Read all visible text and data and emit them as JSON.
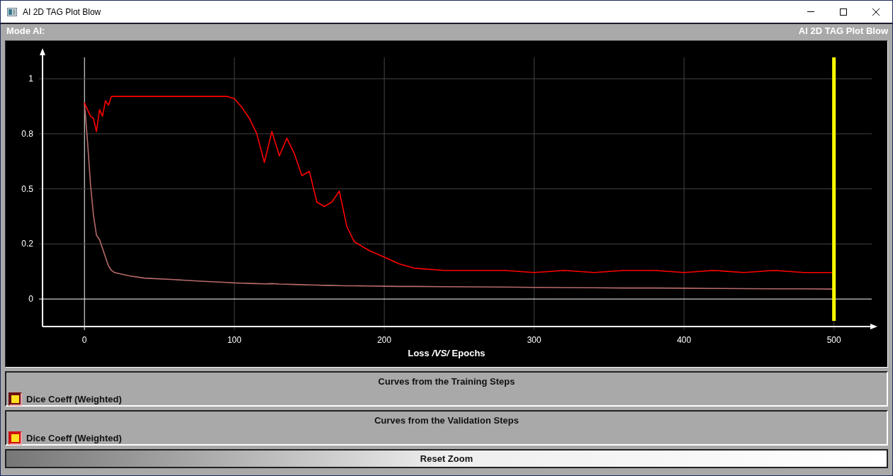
{
  "window": {
    "title": "AI 2D TAG Plot Blow"
  },
  "header": {
    "mode_label": "Mode AI:",
    "app_name": "AI 2D TAG Plot Blow"
  },
  "chart": {
    "chart_data": {
      "type": "line",
      "xlabel": "Loss */VS/* Epochs",
      "xlim": [
        -28,
        529
      ],
      "ylim": [
        -0.125,
        1.11
      ],
      "xticks": [
        0,
        100,
        200,
        300,
        400,
        500
      ],
      "yticks": [
        {
          "value": 0,
          "label": "0"
        },
        {
          "value": 0.25,
          "label": "0.2"
        },
        {
          "value": 0.5,
          "label": "0.5"
        },
        {
          "value": 0.75,
          "label": "0.8"
        },
        {
          "value": 1,
          "label": "1"
        }
      ],
      "x": [
        0,
        2,
        4,
        6,
        8,
        10,
        12,
        14,
        16,
        18,
        20,
        30,
        40,
        60,
        80,
        95,
        100,
        105,
        110,
        115,
        120,
        125,
        130,
        135,
        140,
        145,
        150,
        155,
        160,
        165,
        170,
        175,
        180,
        190,
        200,
        210,
        220,
        240,
        260,
        280,
        300,
        320,
        340,
        360,
        380,
        400,
        420,
        440,
        460,
        480,
        500
      ],
      "series": [
        {
          "color": "#b86a6a",
          "values": [
            0.89,
            0.72,
            0.52,
            0.38,
            0.29,
            0.27,
            0.23,
            0.19,
            0.15,
            0.13,
            0.12,
            0.105,
            0.095,
            0.088,
            0.08,
            0.075,
            0.073,
            0.072,
            0.071,
            0.07,
            0.069,
            0.07,
            0.068,
            0.067,
            0.066,
            0.065,
            0.064,
            0.063,
            0.062,
            0.062,
            0.061,
            0.06,
            0.06,
            0.059,
            0.058,
            0.057,
            0.057,
            0.056,
            0.055,
            0.054,
            0.053,
            0.052,
            0.051,
            0.05,
            0.05,
            0.049,
            0.048,
            0.047,
            0.046,
            0.046,
            0.045
          ]
        },
        {
          "color": "#ff0000",
          "values": [
            0.89,
            0.86,
            0.83,
            0.82,
            0.76,
            0.86,
            0.83,
            0.9,
            0.88,
            0.92,
            0.92,
            0.92,
            0.92,
            0.92,
            0.92,
            0.92,
            0.91,
            0.87,
            0.82,
            0.75,
            0.62,
            0.76,
            0.65,
            0.73,
            0.66,
            0.56,
            0.58,
            0.44,
            0.42,
            0.44,
            0.49,
            0.33,
            0.26,
            0.22,
            0.19,
            0.16,
            0.14,
            0.13,
            0.13,
            0.13,
            0.12,
            0.13,
            0.12,
            0.13,
            0.13,
            0.12,
            0.13,
            0.12,
            0.13,
            0.12,
            0.12
          ]
        }
      ],
      "grid": true,
      "ref_lines": [
        {
          "axis": "x",
          "value": 500,
          "color": "#ffff00"
        }
      ]
    }
  },
  "legend_panels": [
    {
      "title": "Curves from the Training Steps",
      "items": [
        {
          "label": "Dice Coeff (Weighted)",
          "checked": true,
          "color": "#6b1010"
        }
      ]
    },
    {
      "title": "Curves from the Validation Steps",
      "items": [
        {
          "label": "Dice Coeff (Weighted)",
          "checked": true,
          "color": "#d01010"
        }
      ]
    }
  ],
  "buttons": [
    {
      "label": "Reset Zoom"
    }
  ]
}
